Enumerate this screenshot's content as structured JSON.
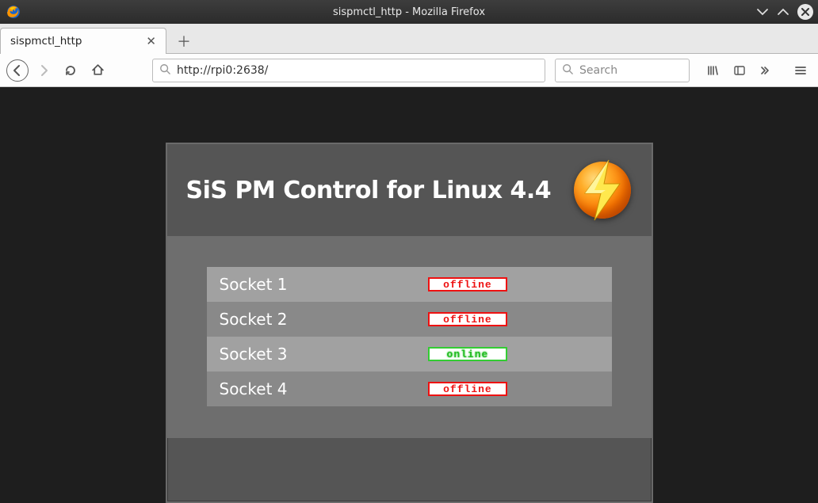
{
  "window": {
    "title": "sispmctl_http - Mozilla Firefox"
  },
  "tab": {
    "label": "sispmctl_http"
  },
  "nav": {
    "url": "http://rpi0:2638/",
    "search_placeholder": "Search"
  },
  "panel": {
    "title": "SiS PM Control for Linux 4.4"
  },
  "sockets": [
    {
      "name": "Socket 1",
      "status": "offline"
    },
    {
      "name": "Socket 2",
      "status": "offline"
    },
    {
      "name": "Socket 3",
      "status": "online"
    },
    {
      "name": "Socket 4",
      "status": "offline"
    }
  ],
  "status_labels": {
    "offline": "offline",
    "online": "online"
  }
}
